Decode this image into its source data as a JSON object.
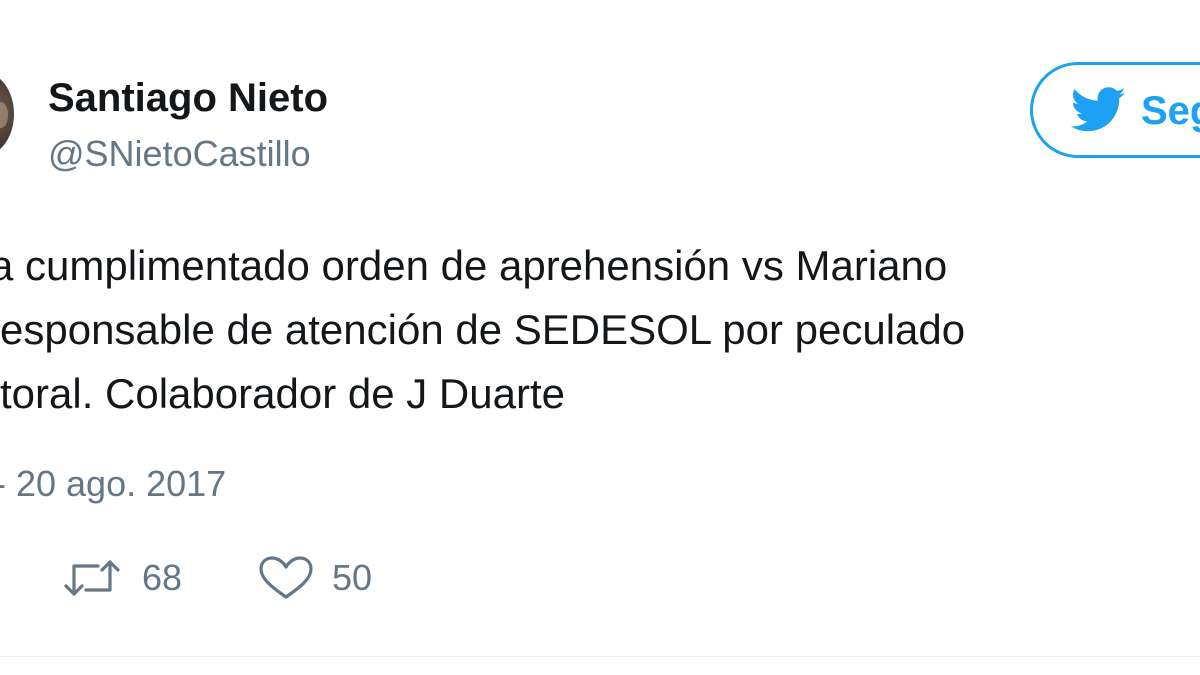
{
  "user": {
    "display_name": "Santiago Nieto",
    "handle": "@SNietoCastillo"
  },
  "follow_button": {
    "label": "Seg",
    "icon": "twitter-bird-icon"
  },
  "tweet": {
    "lines": [
      "a cumplimentado orden de aprehensión vs Mariano",
      "esponsable de atención de SEDESOL por peculado",
      "toral. Colaborador de J Duarte"
    ],
    "timestamp": "- 20 ago. 2017"
  },
  "actions": {
    "retweet": {
      "icon": "retweet-icon",
      "count": "68"
    },
    "like": {
      "icon": "heart-icon",
      "count": "50"
    }
  },
  "colors": {
    "accent": "#1da1f2",
    "text": "#14171a",
    "secondary": "#657786",
    "divider": "#e6ecf0"
  }
}
